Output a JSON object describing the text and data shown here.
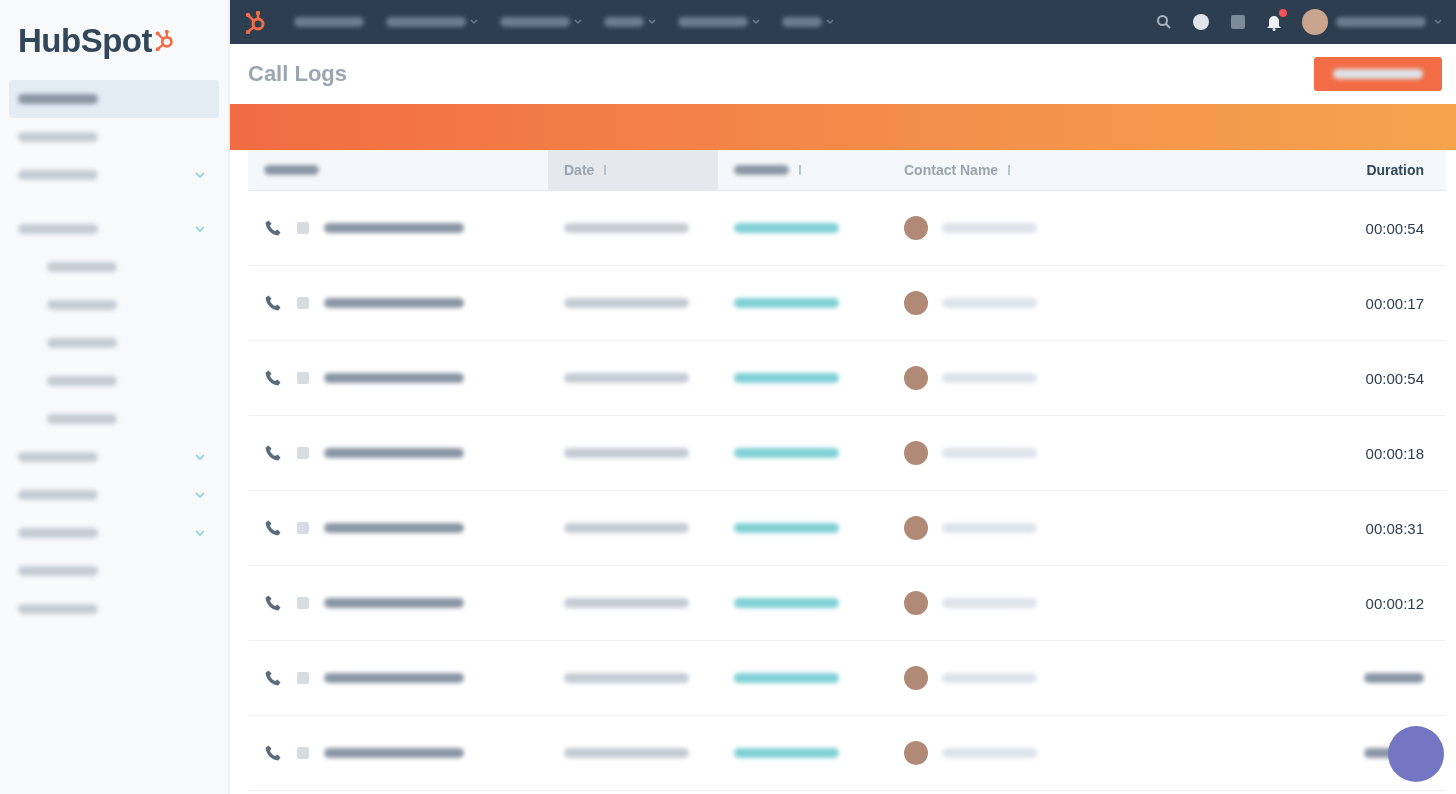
{
  "logo": {
    "text": "HubSpot"
  },
  "sidebar": {
    "items": [
      {
        "selected": true,
        "expandable": false
      },
      {
        "selected": false,
        "expandable": false
      },
      {
        "selected": false,
        "expandable": true
      },
      {
        "selected": false,
        "expandable": true,
        "children": [
          {
            "selected": false
          },
          {
            "selected": false
          },
          {
            "selected": false
          },
          {
            "selected": false
          },
          {
            "selected": false
          }
        ]
      },
      {
        "selected": false,
        "expandable": true
      },
      {
        "selected": false,
        "expandable": true
      },
      {
        "selected": false,
        "expandable": true
      },
      {
        "selected": false,
        "expandable": false
      },
      {
        "selected": false,
        "expandable": false
      }
    ]
  },
  "top_nav": {
    "menus": [
      {
        "has_caret": false
      },
      {
        "has_caret": true
      },
      {
        "has_caret": true
      },
      {
        "has_caret": true
      },
      {
        "has_caret": true
      },
      {
        "has_caret": true
      }
    ],
    "notifications_unread": true
  },
  "page": {
    "title": "Call Logs"
  },
  "table": {
    "columns": [
      {
        "kind": "obscured",
        "sortable": false,
        "sorted": false
      },
      {
        "kind": "label",
        "label": "Date",
        "sortable": true,
        "sorted": true
      },
      {
        "kind": "obscured",
        "sortable": true,
        "sorted": false
      },
      {
        "kind": "label",
        "label": "Contact Name",
        "sortable": true,
        "sorted": false
      },
      {
        "kind": "label",
        "label": "Duration",
        "sortable": false,
        "sorted": false
      }
    ],
    "rows": [
      {
        "duration": "00:00:54"
      },
      {
        "duration": "00:00:17"
      },
      {
        "duration": "00:00:54"
      },
      {
        "duration": "00:00:18"
      },
      {
        "duration": "00:08:31"
      },
      {
        "duration": "00:00:12"
      },
      {
        "duration_obscured": true
      },
      {
        "duration_obscured": true
      }
    ]
  }
}
